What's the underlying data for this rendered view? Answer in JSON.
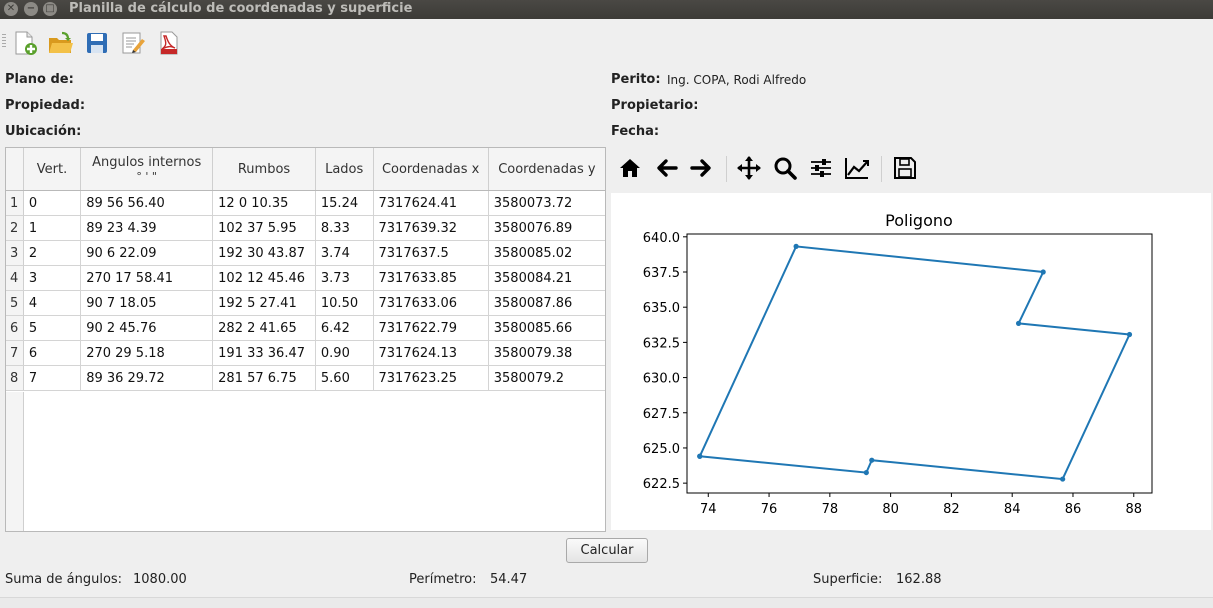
{
  "window": {
    "title": "Planilla de cálculo de coordenadas y superficie"
  },
  "toolbar": {
    "icons": [
      "new-file-icon",
      "open-folder-icon",
      "save-disk-icon",
      "edit-document-icon",
      "pdf-export-icon"
    ]
  },
  "info": {
    "plano_label": "Plano de:",
    "propiedad_label": "Propiedad:",
    "ubicacion_label": "Ubicación:",
    "perito_label": "Perito:",
    "perito_value": "Ing. COPA, Rodi Alfredo",
    "propietario_label": "Propietario:",
    "fecha_label": "Fecha:"
  },
  "table": {
    "headers": {
      "vert": "Vert.",
      "angulos": "Angulos internos",
      "angulos_sub": "°    '    \"",
      "rumbos": "Rumbos",
      "lados": "Lados",
      "coord_x": "Coordenadas x",
      "coord_y": "Coordenadas y"
    },
    "rows": [
      {
        "n": "1",
        "vert": "0",
        "ang": "89  56  56.40",
        "rumbo": "12  0  10.35",
        "lado": "15.24",
        "x": "7317624.41",
        "y": "3580073.72"
      },
      {
        "n": "2",
        "vert": "1",
        "ang": "89  23  4.39",
        "rumbo": "102  37  5.95",
        "lado": "8.33",
        "x": "7317639.32",
        "y": "3580076.89"
      },
      {
        "n": "3",
        "vert": "2",
        "ang": "90  6  22.09",
        "rumbo": "192  30  43.87",
        "lado": "3.74",
        "x": "7317637.5",
        "y": "3580085.02"
      },
      {
        "n": "4",
        "vert": "3",
        "ang": "270  17  58.41",
        "rumbo": "102  12  45.46",
        "lado": "3.73",
        "x": "7317633.85",
        "y": "3580084.21"
      },
      {
        "n": "5",
        "vert": "4",
        "ang": "90  7  18.05",
        "rumbo": "192  5  27.41",
        "lado": "10.50",
        "x": "7317633.06",
        "y": "3580087.86"
      },
      {
        "n": "6",
        "vert": "5",
        "ang": "90  2  45.76",
        "rumbo": "282  2  41.65",
        "lado": "6.42",
        "x": "7317622.79",
        "y": "3580085.66"
      },
      {
        "n": "7",
        "vert": "6",
        "ang": "270  29  5.18",
        "rumbo": "191  33  36.47",
        "lado": "0.90",
        "x": "7317624.13",
        "y": "3580079.38"
      },
      {
        "n": "8",
        "vert": "7",
        "ang": "89  36  29.72",
        "rumbo": "281  57  6.75",
        "lado": "5.60",
        "x": "7317623.25",
        "y": "3580079.2"
      }
    ]
  },
  "plot_toolbar": {
    "icons": [
      "home-icon",
      "back-arrow-icon",
      "forward-arrow-icon",
      "pan-move-icon",
      "zoom-icon",
      "configure-subplots-icon",
      "edit-axis-icon",
      "save-figure-icon"
    ]
  },
  "chart_data": {
    "type": "line",
    "title": "Poligono",
    "xlabel": "",
    "ylabel": "",
    "xlim": [
      73.3,
      88.6
    ],
    "ylim": [
      621.8,
      640.2
    ],
    "xticks": [
      "74",
      "76",
      "78",
      "80",
      "82",
      "84",
      "86",
      "88"
    ],
    "yticks": [
      "622.5",
      "625.0",
      "627.5",
      "630.0",
      "632.5",
      "635.0",
      "637.5",
      "640.0"
    ],
    "series": [
      {
        "color": "#1f77b4",
        "x": [
          73.72,
          76.89,
          85.02,
          84.21,
          87.86,
          85.66,
          79.38,
          79.2,
          73.72
        ],
        "y": [
          624.41,
          639.32,
          637.5,
          633.85,
          633.06,
          622.79,
          624.13,
          623.25,
          624.41
        ]
      }
    ],
    "grid": false
  },
  "actions": {
    "calcular_label": "Calcular"
  },
  "results": {
    "suma_label": "Suma de ángulos:",
    "suma_value": "1080.00",
    "perimetro_label": "Perímetro:",
    "perimetro_value": "54.47",
    "superficie_label": "Superficie:",
    "superficie_value": "162.88"
  },
  "colors": {
    "line": "#1f77b4",
    "titlebar": "#3c3b37"
  }
}
